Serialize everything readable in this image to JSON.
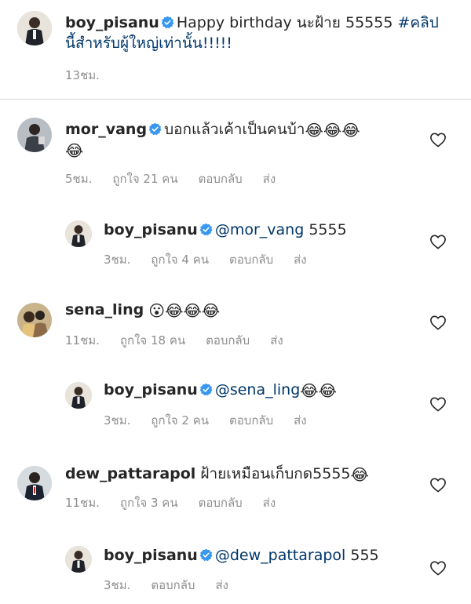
{
  "post": {
    "username": "boy_pisanu",
    "caption_text": "Happy birthday นะฝ้าย 55555 ",
    "hashtag": "#คลิป",
    "caption_line2": "นี้สำหรับผู้ใหญ่เท่านั้น!!!!!",
    "time": "13ชม."
  },
  "comments": [
    {
      "username": "mor_vang",
      "verified": true,
      "text": "บอกแล้วเค้าเป็นคนบ้า",
      "emoji_line1": "😂😂😂",
      "emoji_line2": "😂",
      "time": "5ชม.",
      "likes": "ถูกใจ 21 คน",
      "reply": "ตอบกลับ",
      "send": "ส่ง"
    },
    {
      "username": "boy_pisanu",
      "verified": true,
      "mention": "@mor_vang",
      "text": " 5555",
      "time": "3ชม.",
      "likes": "ถูกใจ 4 คน",
      "reply": "ตอบกลับ",
      "send": "ส่ง"
    },
    {
      "username": "sena_ling",
      "verified": false,
      "emoji": "😮😂😂😂",
      "time": "11ชม.",
      "likes": "ถูกใจ 18 คน",
      "reply": "ตอบกลับ",
      "send": "ส่ง"
    },
    {
      "username": "boy_pisanu",
      "verified": true,
      "mention": "@sena_ling",
      "emoji": " 😂😂",
      "time": "3ชม.",
      "likes": "ถูกใจ 2 คน",
      "reply": "ตอบกลับ",
      "send": "ส่ง"
    },
    {
      "username": "dew_pattarapol",
      "verified": false,
      "text": "ฝ้ายเหมือนเก็บกด5555",
      "emoji": "😂",
      "time": "11ชม.",
      "likes": "ถูกใจ 3 คน",
      "reply": "ตอบกลับ",
      "send": "ส่ง"
    },
    {
      "username": "boy_pisanu",
      "verified": true,
      "mention": "@dew_pattarapol",
      "text": " 555",
      "time": "3ชม.",
      "reply": "ตอบกลับ",
      "send": "ส่ง"
    }
  ],
  "icons": {
    "verified": "verified-badge-icon",
    "like": "heart-outline-icon"
  },
  "colors": {
    "verified": "#3897f0",
    "link": "#00376b",
    "meta": "#8e8e8e",
    "text": "#262626",
    "divider": "#dbdbdb"
  }
}
